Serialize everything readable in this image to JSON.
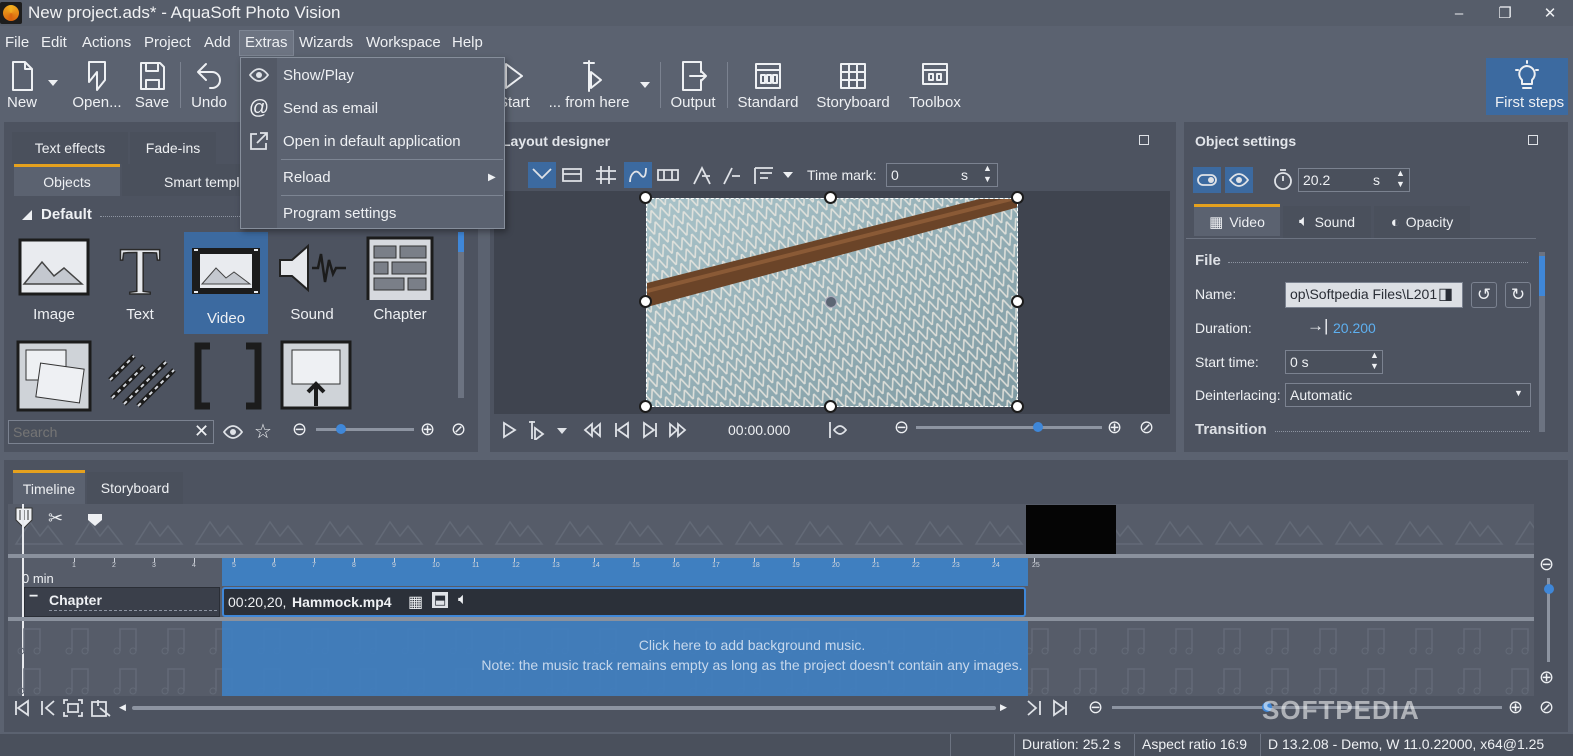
{
  "window": {
    "title": "New project.ads* - AquaSoft Photo Vision",
    "controls": [
      "–",
      "❐",
      "✕"
    ]
  },
  "menu": {
    "file": "File",
    "edit": "Edit",
    "actions": "Actions",
    "project": "Project",
    "add": "Add",
    "extras": "Extras",
    "wizards": "Wizards",
    "workspace": "Workspace",
    "help": "Help"
  },
  "toolbar": {
    "new": "New",
    "open": "Open...",
    "save": "Save",
    "undo": "Undo",
    "start": "Start",
    "from_here": "... from here",
    "output": "Output",
    "standard": "Standard",
    "storyboard": "Storyboard",
    "toolbox": "Toolbox",
    "first_steps": "First steps"
  },
  "extras_menu": {
    "show_play": "Show/Play",
    "send_email": "Send as email",
    "open_default": "Open in default application",
    "reload": "Reload",
    "program_settings": "Program settings"
  },
  "toolbox_panel": {
    "tabs": [
      "Text effects",
      "Fade-ins",
      "Objects",
      "Smart templ"
    ],
    "group": "Default",
    "items": [
      "Image",
      "Text",
      "Video",
      "Sound",
      "Chapter"
    ],
    "search_placeholder": "Search"
  },
  "layout_designer": {
    "title": "Layout designer",
    "time_mark_label": "Time mark:",
    "time_mark_value": "0",
    "time_mark_unit": "s",
    "timecode": "00:00.000"
  },
  "object_settings": {
    "title": "Object settings",
    "duration_value": "20.2",
    "duration_unit": "s",
    "tabs": [
      "Video",
      "Sound",
      "Opacity"
    ],
    "section_file": "File",
    "name_label": "Name:",
    "name_value": "op\\Softpedia Files\\L201",
    "duration_label": "Duration:",
    "duration_link": "20.200",
    "start_time_label": "Start time:",
    "start_time_value": "0 s",
    "deinterlacing_label": "Deinterlacing:",
    "deinterlacing_value": "Automatic",
    "section_transition": "Transition"
  },
  "timeline": {
    "tabs": [
      "Timeline",
      "Storyboard"
    ],
    "zero_label": "0 min",
    "chapter_label": "Chapter",
    "clip_label_time": "00:20,20,",
    "clip_label_name": "Hammock.mp4",
    "music_line1": "Click here to add background music.",
    "music_line2": "Note: the music track remains empty as long as the project doesn't contain any images.",
    "ruler_ticks": [
      "1",
      "2",
      "3",
      "4",
      "5",
      "6",
      "7",
      "8",
      "9",
      "10",
      "11",
      "12",
      "13",
      "14",
      "15",
      "16",
      "17",
      "18",
      "19",
      "20",
      "21",
      "22",
      "23",
      "24",
      "25"
    ]
  },
  "status": {
    "duration": "Duration: 25.2 s",
    "aspect": "Aspect ratio 16:9",
    "version": "D 13.2.08 - Demo, W 11.0.22000, x64@1.25"
  },
  "watermark": "SOFTPEDIA",
  "colors": {
    "accent_blue": "#3c6aa0",
    "link_blue": "#5eb0f0",
    "tab_orange": "#e5a11e",
    "panel": "#4d5360"
  }
}
